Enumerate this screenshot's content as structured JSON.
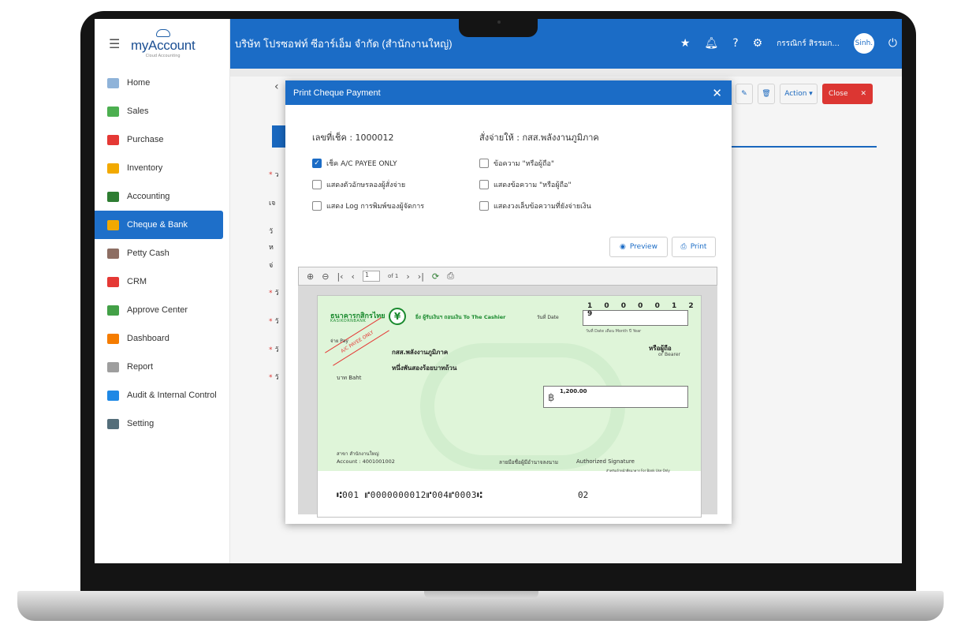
{
  "app": {
    "logo": "myAccount",
    "logo_sub": "Cloud Accounting",
    "company": "บริษัท โปรซอฟท์ ซีอาร์เอ็ม จำกัด (สำนักงานใหญ่)",
    "user_name": "กรรณิกร์ สิรรมก...",
    "avatar_text": "Sinh."
  },
  "sidebar": {
    "items": [
      {
        "label": "Home",
        "icon": "home-icon",
        "color": "#8fb3d9"
      },
      {
        "label": "Sales",
        "icon": "sales-icon",
        "color": "#4caf50"
      },
      {
        "label": "Purchase",
        "icon": "cart-icon",
        "color": "#e53935"
      },
      {
        "label": "Inventory",
        "icon": "box-icon",
        "color": "#f2a900"
      },
      {
        "label": "Accounting",
        "icon": "book-icon",
        "color": "#2e7d32"
      },
      {
        "label": "Cheque & Bank",
        "icon": "bank-icon",
        "color": "#f2a900"
      },
      {
        "label": "Petty Cash",
        "icon": "cash-icon",
        "color": "#8d6e63"
      },
      {
        "label": "CRM",
        "icon": "crm-icon",
        "color": "#e53935"
      },
      {
        "label": "Approve Center",
        "icon": "check-circle-icon",
        "color": "#43a047"
      },
      {
        "label": "Dashboard",
        "icon": "pie-chart-icon",
        "color": "#f57c00"
      },
      {
        "label": "Report",
        "icon": "report-icon",
        "color": "#9e9e9e"
      },
      {
        "label": "Audit & Internal Control",
        "icon": "search-icon",
        "color": "#1e88e5"
      },
      {
        "label": "Setting",
        "icon": "tools-icon",
        "color": "#546e7a"
      }
    ]
  },
  "toolbar": {
    "action_label": "Action",
    "close_label": "Close"
  },
  "form_labels": {
    "l1": "ว",
    "l2": "เจ",
    "l3": "วั",
    "l4": "ห",
    "l5": "จ่",
    "l6": "วั",
    "l7": "วั",
    "l8": "วั",
    "l9": "วั"
  },
  "modal": {
    "title": "Print Cheque Payment",
    "cheque_no": "เลขที่เช็ค : 1000012",
    "payee": "สั่งจ่ายให้ : กสส.พลังงานภูมิภาค",
    "options": [
      {
        "label": "เช็ค A/C PAYEE ONLY",
        "checked": true
      },
      {
        "label": "ข้อความ \"หรือผู้ถือ\"",
        "checked": false
      },
      {
        "label": "แสดงตัวอักษรลองผู้สั่งจ่าย",
        "checked": false
      },
      {
        "label": "แสดงข้อความ \"หรือผู้ถือ\"",
        "checked": false
      },
      {
        "label": "แสดง Log การพิมพ์ของผู้จัดการ",
        "checked": false
      },
      {
        "label": "แสดงวงเล็บข้อความที่ยังจ่ายเงิน",
        "checked": false
      }
    ],
    "preview_label": "Preview",
    "print_label": "Print",
    "viewer": {
      "page": "1",
      "of_pages": "of 1"
    }
  },
  "cheque": {
    "bank_name": "ธนาคารกสิกรไทย",
    "bank_sub": "KASIKORNBANK",
    "payee_note": "ยิ่ง ผู้รับเงินฯ ถอนเงิน To The Cashier",
    "date_label": "วันที่ Date",
    "date_digits": "1 0 0 0 0 1 2 9",
    "date_sub": "วันที่ Date   เดือน Month   ปี Year",
    "stamp": "A/C PAYEE ONLY",
    "pay_label": "จ่าย Pay",
    "pay_to": "กสส.พลังงานภูมิภาค",
    "bearer": "หรือผู้ถือ",
    "bearer_en": "or Bearer",
    "amount_words": "หนึ่งพันสองร้อยบาทถ้วน",
    "baht_label": "บาท Baht",
    "baht_symbol": "฿",
    "amount": "1,200.00",
    "branch": "สาขา สำนักงานใหญ่",
    "account": "Account : 4001001002",
    "signature_label": "ลายมือชื่อผู้มีอำนาจลงนาม",
    "signature_en": "Authorized Signature",
    "bank_use": "สำหรับเจ้าหน้าที่ธนาคาร For Bank Use Only",
    "micr": "⑆001 ⑈0000000012⑈004⑈0003⑆",
    "micr_code": "02"
  }
}
